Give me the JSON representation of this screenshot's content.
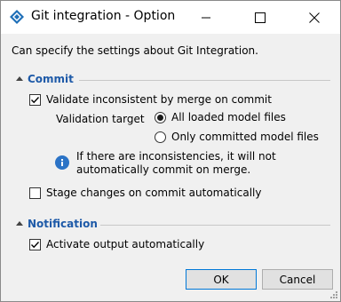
{
  "window": {
    "title": "Git integration - Option",
    "icon": "app-diamond-icon"
  },
  "description": "Can specify the settings about Git Integration.",
  "sections": {
    "commit": {
      "label": "Commit",
      "validate": {
        "label": "Validate inconsistent by merge on commit",
        "checked": true
      },
      "validation_target": {
        "label": "Validation target",
        "options": [
          {
            "label": "All loaded model files",
            "selected": true
          },
          {
            "label": "Only committed model files",
            "selected": false
          }
        ]
      },
      "info": {
        "icon": "info-icon",
        "line1": "If there are inconsistencies, it will not",
        "line2": "automatically commit on merge."
      },
      "stage": {
        "label": "Stage changes on commit automatically",
        "checked": false
      }
    },
    "notification": {
      "label": "Notification",
      "activate": {
        "label": "Activate output automatically",
        "checked": true
      }
    }
  },
  "buttons": {
    "ok": "OK",
    "cancel": "Cancel"
  },
  "colors": {
    "section_header": "#1e5aa8",
    "info_icon": "#2b73c6",
    "ok_border": "#0078d7"
  }
}
